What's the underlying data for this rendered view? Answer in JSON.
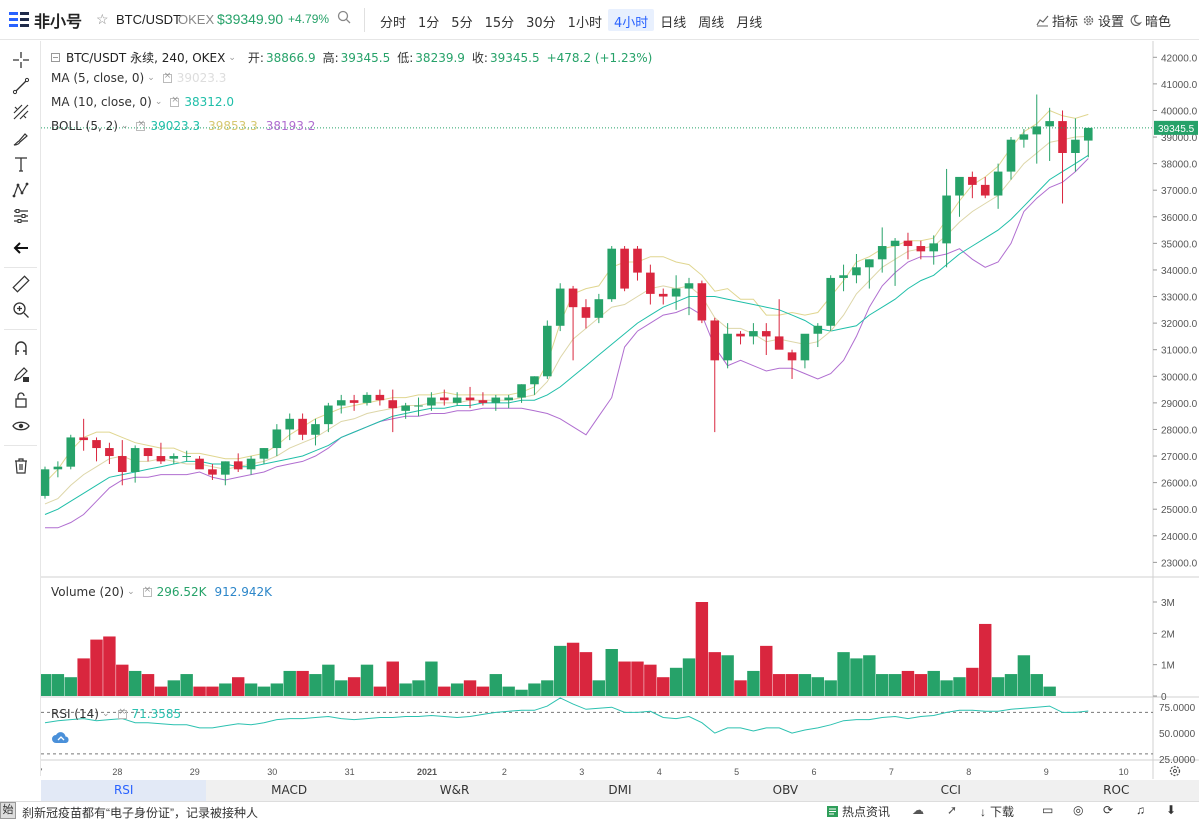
{
  "app": {
    "logo_text": "非小号"
  },
  "header": {
    "symbol": "BTC/USDT",
    "exchange": "OKEX",
    "price": "$39349.90",
    "change_pct": "+4.79%",
    "intervals": [
      "分时",
      "1分",
      "5分",
      "15分",
      "30分",
      "1小时",
      "4小时",
      "日线",
      "周线",
      "月线"
    ],
    "active_interval": "4小时",
    "indicators_label": "指标",
    "settings_label": "设置",
    "theme_label": "暗色"
  },
  "legend": {
    "main": {
      "title": "BTC/USDT 永续, 240, OKEX",
      "open_label": "开:",
      "open": "38866.9",
      "high_label": "高:",
      "high": "39345.5",
      "low_label": "低:",
      "low": "38239.9",
      "close_label": "收:",
      "close": "39345.5",
      "change": "+478.2 (+1.23%)"
    },
    "ma5": {
      "label": "MA (5, close, 0)",
      "value": "39023.3"
    },
    "ma10": {
      "label": "MA (10, close, 0)",
      "value": "38312.0"
    },
    "boll": {
      "label": "BOLL (5, 2)",
      "mid": "39023.3",
      "upper": "39853.3",
      "lower": "38193.2"
    },
    "volume": {
      "label": "Volume (20)",
      "value1": "296.52K",
      "value2": "912.942K"
    },
    "rsi": {
      "label": "RSI (14)",
      "value": "71.3585"
    }
  },
  "price_axis": {
    "ticks": [
      "42000.0",
      "41000.0",
      "40000.0",
      "39000.0",
      "38000.0",
      "37000.0",
      "36000.0",
      "35000.0",
      "34000.0",
      "33000.0",
      "32000.0",
      "31000.0",
      "30000.0",
      "29000.0",
      "28000.0",
      "27000.0",
      "26000.0",
      "25000.0",
      "24000.0",
      "23000.0"
    ],
    "last_price": "39345.5"
  },
  "volume_axis": {
    "ticks": [
      "3M",
      "2M",
      "1M",
      "0"
    ]
  },
  "rsi_axis": {
    "ticks": [
      "75.0000",
      "50.0000",
      "25.0000"
    ]
  },
  "time_axis": {
    "labels": [
      "7",
      "28",
      "29",
      "30",
      "31",
      "2021",
      "2",
      "3",
      "4",
      "5",
      "6",
      "7",
      "8",
      "9",
      "10"
    ]
  },
  "bottom_tabs": [
    "RSI",
    "MACD",
    "W&R",
    "DMI",
    "OBV",
    "CCI",
    "ROC"
  ],
  "active_bottom_tab": "RSI",
  "statusbar": {
    "start": "始",
    "ticker": "刹新冠疫苗都有“电子身份证”，记录被接种人",
    "hot_news": "热点资讯",
    "download": "下载"
  },
  "colors": {
    "up": "#26a269",
    "down": "#d9263e",
    "accent": "#2962ff",
    "ma5": "#c9a227",
    "ma10": "#20bfa9",
    "boll_upper": "#e0d690",
    "boll_lower": "#b06ed0",
    "rsi": "#2cc1b0"
  },
  "chart_data": {
    "type": "candlestick",
    "interval": "4小时",
    "candles": [
      [
        25500,
        26600,
        25400,
        26500
      ],
      [
        26500,
        26800,
        26200,
        26600
      ],
      [
        26600,
        27800,
        26500,
        27700
      ],
      [
        27700,
        28400,
        27200,
        27600
      ],
      [
        27600,
        27700,
        26800,
        27300
      ],
      [
        27300,
        27500,
        26700,
        27000
      ],
      [
        27000,
        27600,
        25900,
        26400
      ],
      [
        26400,
        27400,
        26000,
        27300
      ],
      [
        27300,
        27300,
        26800,
        27000
      ],
      [
        27000,
        27500,
        26700,
        26800
      ],
      [
        26900,
        27100,
        26700,
        27000
      ],
      [
        27000,
        27200,
        26800,
        27000
      ],
      [
        26900,
        27000,
        26600,
        26500
      ],
      [
        26500,
        26700,
        26100,
        26300
      ],
      [
        26300,
        26800,
        25900,
        26800
      ],
      [
        26800,
        27100,
        26400,
        26500
      ],
      [
        26500,
        27000,
        26300,
        26900
      ],
      [
        26900,
        27300,
        26700,
        27300
      ],
      [
        27300,
        28200,
        27000,
        28000
      ],
      [
        28000,
        28600,
        27600,
        28400
      ],
      [
        28400,
        28600,
        27600,
        27800
      ],
      [
        27800,
        28400,
        27400,
        28200
      ],
      [
        28200,
        29000,
        27900,
        28900
      ],
      [
        28900,
        29300,
        28600,
        29100
      ],
      [
        29100,
        29300,
        28700,
        29000
      ],
      [
        29000,
        29400,
        28900,
        29300
      ],
      [
        29300,
        29500,
        28900,
        29100
      ],
      [
        29100,
        29500,
        27900,
        28800
      ],
      [
        28700,
        29000,
        28400,
        28900
      ],
      [
        28900,
        29200,
        28500,
        28900
      ],
      [
        28900,
        29400,
        28700,
        29200
      ],
      [
        29200,
        29500,
        28900,
        29100
      ],
      [
        29000,
        29400,
        28900,
        29200
      ],
      [
        29200,
        29600,
        28800,
        29100
      ],
      [
        29100,
        29400,
        28900,
        29000
      ],
      [
        29000,
        29300,
        28700,
        29200
      ],
      [
        29100,
        29300,
        28800,
        29200
      ],
      [
        29200,
        29700,
        29000,
        29700
      ],
      [
        29700,
        30000,
        29300,
        30000
      ],
      [
        30000,
        32100,
        29900,
        31900
      ],
      [
        31900,
        33500,
        31700,
        33300
      ],
      [
        33300,
        33400,
        30600,
        32600
      ],
      [
        32600,
        32900,
        31800,
        32200
      ],
      [
        32200,
        33100,
        32000,
        32900
      ],
      [
        32900,
        34900,
        32800,
        34800
      ],
      [
        34800,
        34900,
        33200,
        33300
      ],
      [
        34800,
        34900,
        33600,
        33900
      ],
      [
        33900,
        34200,
        32700,
        33100
      ],
      [
        33100,
        33300,
        32700,
        33000
      ],
      [
        33000,
        33800,
        32500,
        33300
      ],
      [
        33300,
        33700,
        32300,
        33500
      ],
      [
        33500,
        33600,
        32000,
        32100
      ],
      [
        32100,
        32200,
        27900,
        30600
      ],
      [
        30600,
        32000,
        30300,
        31600
      ],
      [
        31600,
        31700,
        31200,
        31500
      ],
      [
        31500,
        32000,
        31200,
        31700
      ],
      [
        31700,
        32000,
        30800,
        31500
      ],
      [
        31500,
        32900,
        31100,
        31000
      ],
      [
        30900,
        31000,
        29900,
        30600
      ],
      [
        30600,
        31400,
        30300,
        31600
      ],
      [
        31600,
        32000,
        31100,
        31900
      ],
      [
        31900,
        33800,
        31700,
        33700
      ],
      [
        33700,
        34200,
        33200,
        33800
      ],
      [
        33800,
        34600,
        33500,
        34100
      ],
      [
        34100,
        34400,
        33300,
        34400
      ],
      [
        34400,
        35600,
        33900,
        34900
      ],
      [
        34900,
        35200,
        33400,
        35100
      ],
      [
        35100,
        35400,
        34400,
        34900
      ],
      [
        34900,
        35100,
        34400,
        34700
      ],
      [
        34700,
        35300,
        34200,
        35000
      ],
      [
        35000,
        37800,
        34100,
        36800
      ],
      [
        36800,
        37200,
        36000,
        37500
      ],
      [
        37500,
        37700,
        36700,
        37200
      ],
      [
        37200,
        37500,
        36700,
        36800
      ],
      [
        36800,
        38000,
        36300,
        37700
      ],
      [
        37700,
        39000,
        37400,
        38900
      ],
      [
        38900,
        39300,
        38600,
        39100
      ],
      [
        39100,
        40600,
        38000,
        39400
      ],
      [
        39400,
        40100,
        38100,
        39600
      ],
      [
        39600,
        40000,
        36500,
        38400
      ],
      [
        38400,
        39700,
        37700,
        38900
      ],
      [
        38866.9,
        39345.5,
        38239.9,
        39345.5
      ]
    ],
    "ma5": [
      25200,
      25400,
      25900,
      26300,
      26600,
      26900,
      27000,
      26800,
      26800,
      26900,
      26800,
      26700,
      26700,
      26600,
      26500,
      26600,
      26700,
      26800,
      27000,
      27300,
      27500,
      27700,
      28000,
      28300,
      28400,
      28600,
      28700,
      28800,
      28900,
      28900,
      29000,
      29000,
      29000,
      29100,
      29100,
      29100,
      29100,
      29200,
      29300,
      29800,
      30700,
      31400,
      31800,
      32200,
      32600,
      32700,
      33000,
      33300,
      33400,
      33300,
      33400,
      33000,
      32200,
      31800,
      31800,
      31600,
      31300,
      31400,
      31300,
      31200,
      31300,
      31700,
      32300,
      33100,
      33600,
      34100,
      34400,
      34700,
      34800,
      34900,
      35300,
      35800,
      36200,
      36500,
      36800,
      37400,
      38000,
      38400,
      38800,
      38900,
      39000,
      39023.3
    ],
    "ma10": [
      24800,
      25000,
      25300,
      25600,
      25900,
      26200,
      26300,
      26400,
      26500,
      26600,
      26700,
      26800,
      26800,
      26700,
      26700,
      26600,
      26600,
      26700,
      26800,
      26900,
      27000,
      27200,
      27400,
      27700,
      27900,
      28100,
      28300,
      28500,
      28600,
      28700,
      28800,
      28800,
      28900,
      28900,
      29000,
      29000,
      29000,
      29100,
      29100,
      29300,
      29600,
      30000,
      30400,
      30800,
      31200,
      31600,
      32000,
      32300,
      32600,
      32800,
      33000,
      33000,
      33000,
      32900,
      32800,
      32700,
      32600,
      32500,
      32300,
      32100,
      31800,
      31700,
      31800,
      31900,
      32300,
      32600,
      32900,
      33300,
      33600,
      33800,
      34200,
      34600,
      34900,
      35200,
      35500,
      35900,
      36400,
      36900,
      37400,
      37700,
      38000,
      38312.0
    ],
    "boll_upper": [
      26000,
      26500,
      27200,
      27700,
      27900,
      27900,
      27700,
      27500,
      27400,
      27300,
      27300,
      27100,
      27100,
      27000,
      26900,
      26900,
      27000,
      27100,
      27400,
      27800,
      28100,
      28400,
      28600,
      28800,
      28900,
      29000,
      29100,
      29200,
      29200,
      29300,
      29300,
      29400,
      29300,
      29300,
      29300,
      29300,
      29300,
      29400,
      29600,
      30500,
      32000,
      33100,
      33300,
      33400,
      34100,
      34300,
      34300,
      34500,
      34500,
      34300,
      34200,
      33800,
      33200,
      33300,
      32900,
      32900,
      32300,
      32300,
      32400,
      32300,
      32400,
      33000,
      33600,
      34300,
      34500,
      34800,
      34900,
      35100,
      35100,
      35200,
      35900,
      36600,
      37200,
      37500,
      37900,
      38600,
      39200,
      39500,
      40000,
      39800,
      39700,
      39853.3
    ],
    "boll_lower": [
      24300,
      24300,
      24500,
      24800,
      25300,
      25800,
      26100,
      26200,
      26200,
      26300,
      26300,
      26300,
      26400,
      26200,
      26100,
      26200,
      26300,
      26400,
      26600,
      26700,
      26800,
      27000,
      27300,
      27700,
      27900,
      28100,
      28300,
      28400,
      28500,
      28500,
      28600,
      28600,
      28700,
      28700,
      28800,
      28800,
      28800,
      28800,
      28700,
      28600,
      28400,
      28100,
      27800,
      28500,
      29200,
      31100,
      31700,
      32000,
      32300,
      32400,
      32600,
      32300,
      31100,
      30400,
      30600,
      30400,
      30200,
      30300,
      30300,
      30100,
      29900,
      30100,
      30600,
      31500,
      32600,
      33400,
      33900,
      34300,
      34500,
      34500,
      34600,
      34800,
      34400,
      34100,
      34300,
      35000,
      36200,
      36700,
      37100,
      37300,
      37700,
      38193.2
    ],
    "volume": [
      700000,
      700000,
      600000,
      1200000,
      1800000,
      1900000,
      1000000,
      800000,
      700000,
      300000,
      500000,
      700000,
      300000,
      300000,
      400000,
      600000,
      400000,
      300000,
      400000,
      800000,
      800000,
      700000,
      1000000,
      500000,
      600000,
      1000000,
      300000,
      1100000,
      400000,
      500000,
      1100000,
      300000,
      400000,
      500000,
      300000,
      700000,
      300000,
      200000,
      400000,
      500000,
      1600000,
      1700000,
      1400000,
      500000,
      1500000,
      1100000,
      1100000,
      1000000,
      600000,
      900000,
      1200000,
      3000000,
      1400000,
      1300000,
      500000,
      800000,
      1600000,
      700000,
      700000,
      700000,
      600000,
      500000,
      1400000,
      1200000,
      1300000,
      700000,
      700000,
      800000,
      700000,
      800000,
      500000,
      600000,
      900000,
      2300000,
      600000,
      700000,
      1300000,
      700000,
      300000
    ],
    "rsi": [
      60,
      62,
      63,
      64,
      62,
      63,
      64,
      60,
      60,
      59,
      58,
      58,
      55,
      55,
      57,
      59,
      58,
      60,
      63,
      64,
      64,
      65,
      66,
      64,
      63,
      64,
      65,
      65,
      66,
      66,
      67,
      66,
      65,
      66,
      68,
      70,
      71,
      72,
      72,
      76,
      84,
      78,
      73,
      74,
      75,
      70,
      70,
      71,
      65,
      64,
      66,
      60,
      50,
      55,
      55,
      52,
      55,
      55,
      50,
      53,
      55,
      58,
      62,
      63,
      63,
      65,
      66,
      64,
      66,
      67,
      70,
      72,
      72,
      71,
      71,
      73,
      74,
      75,
      76,
      70,
      70,
      71.3585
    ],
    "time_labels": [
      "7",
      "28",
      "29",
      "30",
      "31",
      "2021",
      "2",
      "3",
      "4",
      "5",
      "6",
      "7",
      "8",
      "9",
      "10"
    ],
    "price_range": [
      22600,
      42500
    ],
    "volume_range": [
      0,
      3000000
    ],
    "rsi_range": [
      25,
      80
    ],
    "rsi_levels": [
      70,
      30
    ],
    "grid": false
  }
}
